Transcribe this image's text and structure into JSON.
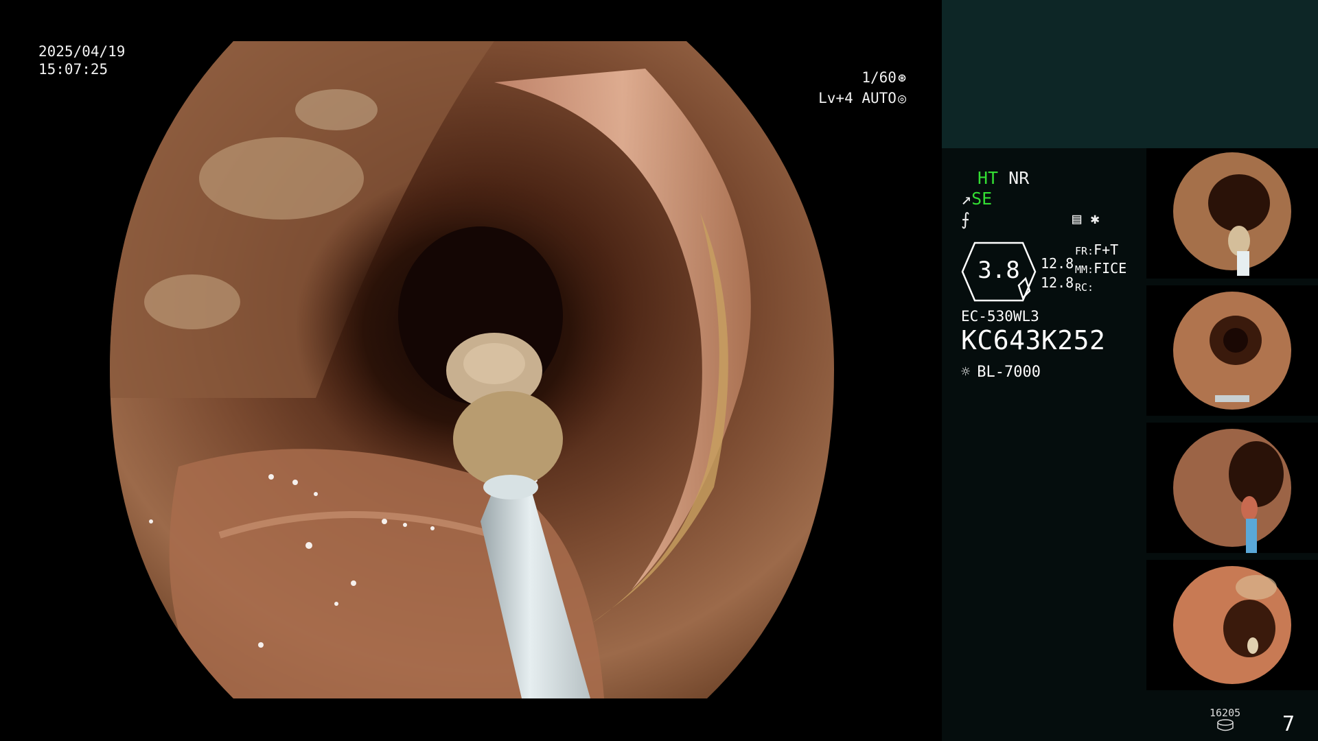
{
  "main": {
    "date": "2025/04/19",
    "time": "15:07:25",
    "shutter": "1/60",
    "light_level": "Lv+4",
    "exposure_mode": "AUTO"
  },
  "panel": {
    "status_ht": "HT",
    "status_nr": "NR",
    "status_se": "SE",
    "ratio": "3.8",
    "val_a": "12.8",
    "val_b": "12.8",
    "fr_label": "FR:",
    "fr_value": "F+T",
    "mm_label": "MM:",
    "mm_value": "FICE",
    "rc_label": "RC:",
    "scope_model": "EC-530WL3",
    "scope_serial": "KC643K252",
    "lamp_model": "BL-7000",
    "image_count": "16205",
    "page_number": "7"
  },
  "icons": [
    "shutter-icon",
    "auto-iris-icon",
    "tool-icon",
    "flash-off-icon",
    "record-icon",
    "asterisk-icon",
    "lamp-icon",
    "disk-icon"
  ],
  "colors": {
    "panel_top": "#0d2626",
    "panel_bg": "#050d0d",
    "status_green": "#33dd33"
  }
}
